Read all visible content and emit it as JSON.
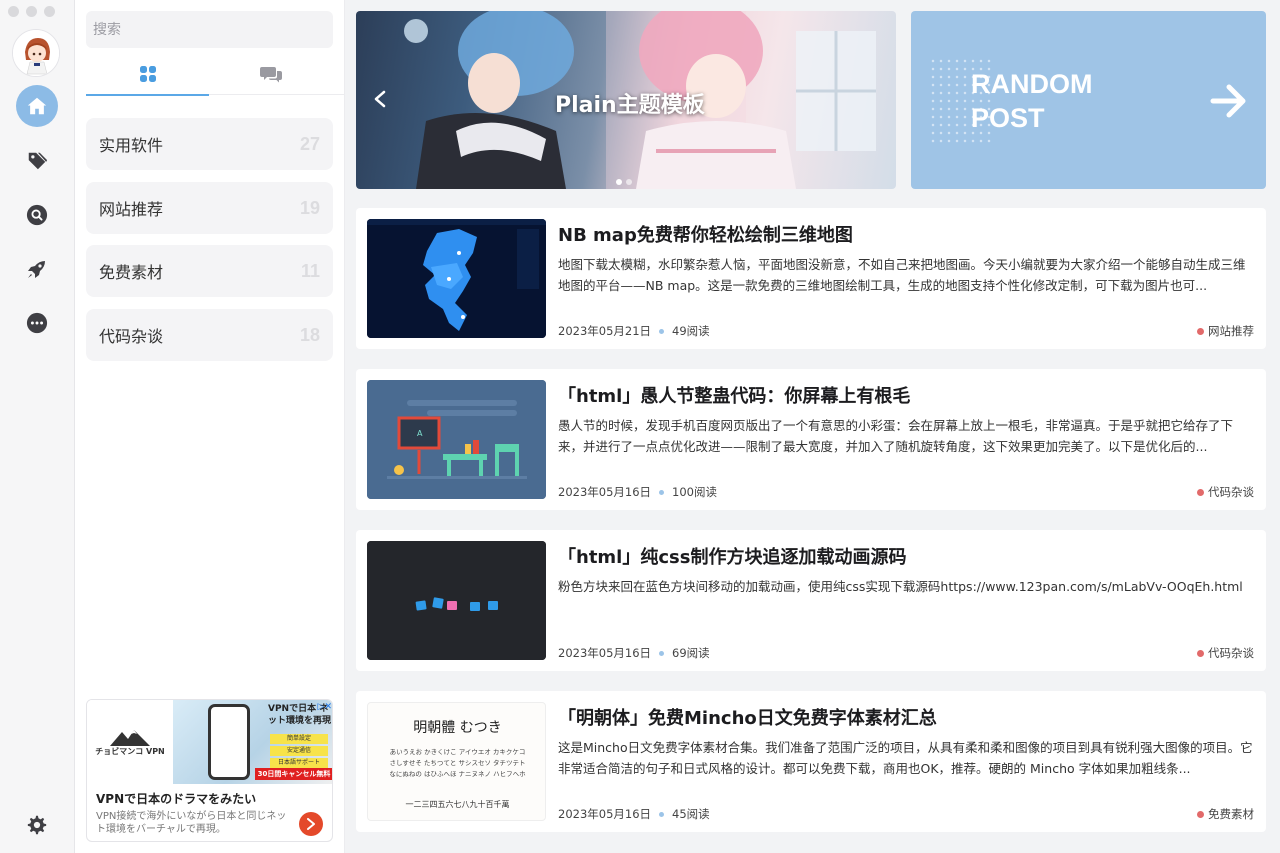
{
  "window": {
    "traffic_lights": [
      "close",
      "minimize",
      "zoom"
    ]
  },
  "rail": {
    "items": [
      {
        "name": "home",
        "icon": "home-icon",
        "active": true
      },
      {
        "name": "tags",
        "icon": "tag-icon",
        "active": false
      },
      {
        "name": "search",
        "icon": "search-icon",
        "active": false
      },
      {
        "name": "launch",
        "icon": "rocket-icon",
        "active": false
      },
      {
        "name": "more",
        "icon": "more-icon",
        "active": false
      }
    ],
    "settings_icon": "gear-icon"
  },
  "panel": {
    "search_placeholder": "搜索",
    "tabs": [
      {
        "icon": "grid-icon",
        "active": true
      },
      {
        "icon": "chat-icon",
        "active": false
      }
    ],
    "categories": [
      {
        "name": "实用软件",
        "count": "27"
      },
      {
        "name": "网站推荐",
        "count": "19"
      },
      {
        "name": "免费素材",
        "count": "11"
      },
      {
        "name": "代码杂谈",
        "count": "18"
      }
    ],
    "ad": {
      "logo_text": "チョビマンコ VPN",
      "headline_jp": "VPNで日本 ネット環境を再現",
      "chips": [
        "簡単設定",
        "安定通信",
        "日本語サポート"
      ],
      "cancel_text": "30日間キャンセル無料",
      "title": "VPNで日本のドラマをみたい",
      "description": "VPN接続で海外にいながら日本と同じネット環境をバーチャルで再現。"
    }
  },
  "banner": {
    "title": "Plain主题模板",
    "slides": 2,
    "current": 0
  },
  "random": {
    "line1": "RANDOM",
    "line2": "POST"
  },
  "posts": [
    {
      "title": "NB map免费帮你轻松绘制三维地图",
      "excerpt": "地图下载太模糊，水印繁杂惹人恼，平面地图没新意，不如自己来把地图画。今天小编就要为大家介绍一个能够自动生成三维地图的平台——NB map。这是一款免费的三维地图绘制工具，生成的地图支持个性化修改定制，可下载为图片也可...",
      "date": "2023年05月21日",
      "reads": "49阅读",
      "category": "网站推荐",
      "thumb": "map"
    },
    {
      "title": "「html」愚人节整蛊代码：你屏幕上有根毛",
      "excerpt": "愚人节的时候，发现手机百度网页版出了一个有意思的小彩蛋：会在屏幕上放上一根毛，非常逼真。于是乎就把它给存了下来，并进行了一点点优化改进——限制了最大宽度，并加入了随机旋转角度，这下效果更加完美了。以下是优化后的...",
      "date": "2023年05月16日",
      "reads": "100阅读",
      "category": "代码杂谈",
      "thumb": "classroom"
    },
    {
      "title": "「html」纯css制作方块追逐加载动画源码",
      "excerpt": "粉色方块来回在蓝色方块间移动的加载动画，使用纯css实现下载源码https://www.123pan.com/s/mLabVv-OOqEh.html",
      "date": "2023年05月16日",
      "reads": "69阅读",
      "category": "代码杂谈",
      "thumb": "blocks"
    },
    {
      "title": "「明朝体」免费Mincho日文免费字体素材汇总",
      "excerpt": "这是Mincho日文免费字体素材合集。我们准备了范围广泛的项目，从具有柔和柔和图像的项目到具有锐利强大图像的项目。它非常适合简洁的句子和日式风格的设计。都可以免费下载，商用也OK，推荐。硬朗的 Mincho 字体如果加粗线条...",
      "date": "2023年05月16日",
      "reads": "45阅读",
      "category": "免费素材",
      "thumb": "font",
      "thumb_text": {
        "heading": "明朝體 むつき",
        "line1": "あいうえお かきくけこ アイウエオ カキクケコ",
        "line2": "さしすせそ たちつてと サシスセソ タチツテト",
        "line3": "なにぬねの はひふへほ ナニヌネノ ハヒフヘホ",
        "line4": "一二三四五六七八九十百千萬"
      }
    }
  ],
  "colors": {
    "accent": "#5ba8e7",
    "rail_active": "#8cbbe6",
    "random_bg": "#9fc4e6",
    "category_dot": "#e26a6a"
  }
}
